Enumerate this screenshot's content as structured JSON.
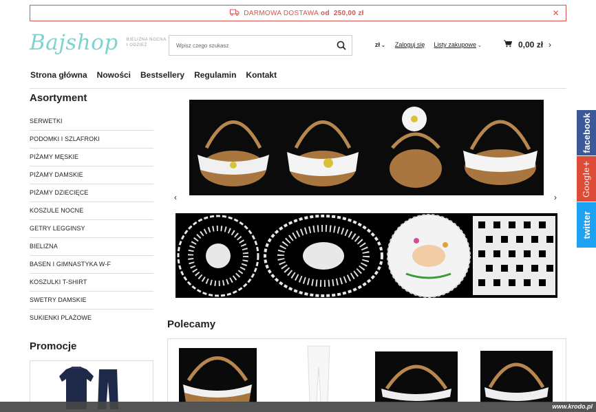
{
  "promo": {
    "text": "DARMOWA DOSTAWA",
    "mid": "od",
    "amount": "250,00 zł"
  },
  "logo": {
    "brand": "Bajshop",
    "tagline": "BIELIZNA NOCNA I ODZIEŻ"
  },
  "search": {
    "placeholder": "Wpisz czego szukasz"
  },
  "header": {
    "currency": "zł",
    "login": "Zaloguj się",
    "lists": "Listy zakupowe",
    "cart_total": "0,00 zł"
  },
  "nav": [
    "Strona główna",
    "Nowości",
    "Bestsellery",
    "Regulamin",
    "Kontakt"
  ],
  "sidebar": {
    "title": "Asortyment",
    "categories": [
      "SERWETKI",
      "PODOMKI I SZLAFROKI",
      "PIŻAMY MĘSKIE",
      "PIŻAMY DAMSKIE",
      "PIŻAMY DZIECIĘCE",
      "KOSZULE NOCNE",
      "GETRY LEGGINSY",
      "BIELIZNA",
      "BASEN I GIMNASTYKA W-F",
      "KOSZULKI T-SHIRT",
      "SWETRY DAMSKIE",
      "SUKIENKI PLAŻOWE"
    ],
    "promo_title": "Promocje"
  },
  "main": {
    "section_title": "Polecamy"
  },
  "social": {
    "facebook": "facebook",
    "google": "Google+",
    "twitter": "twitter"
  },
  "watermark": "www.krodo.pl",
  "colors": {
    "accent": "#d9534f",
    "logo": "#7fd3cf",
    "facebook": "#3b5998",
    "google": "#dd4b39",
    "twitter": "#1da1f2"
  }
}
